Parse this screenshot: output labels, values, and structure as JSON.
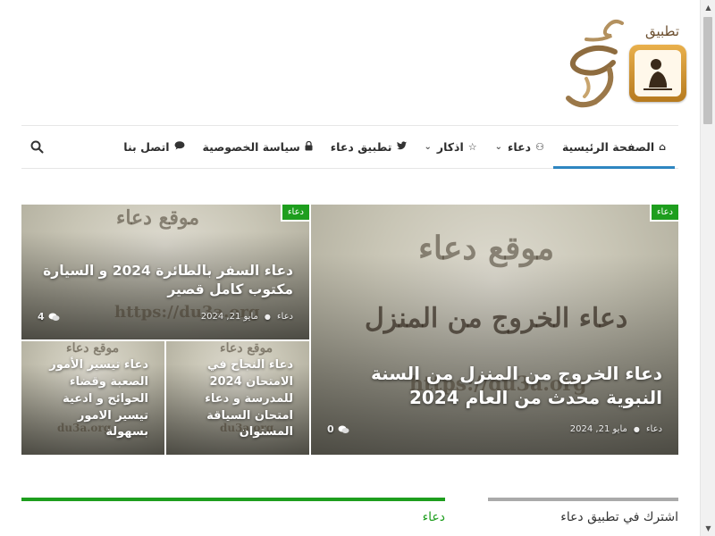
{
  "logo": {
    "app_label": "تطبيق"
  },
  "nav": {
    "items": [
      {
        "label": "الصفحة الرئيسية",
        "icon": "home-icon",
        "active": true
      },
      {
        "label": "دعاء",
        "icon": "gamepad-icon",
        "dropdown": true
      },
      {
        "label": "اذكار",
        "icon": "star-icon",
        "dropdown": true
      },
      {
        "label": "تطبيق دعاء",
        "icon": "twitter-icon"
      },
      {
        "label": "سياسة الخصوصية",
        "icon": "lock-icon"
      },
      {
        "label": "اتصل بنا",
        "icon": "chat-icon"
      }
    ]
  },
  "cards": {
    "main": {
      "tag": "دعاء",
      "title": "دعاء الخروج من المنزل من السنة النبوية محدث من العام 2024",
      "author": "دعاء",
      "date": "مايو 21, 2024",
      "comments": "0",
      "image_text": {
        "line1": "موقع دعاء",
        "line2": "دعاء الخروج من المنزل",
        "url": "https://du3a.org"
      }
    },
    "top_left": {
      "tag": "دعاء",
      "title": "دعاء السفر بالطائرة 2024 و السيارة مكتوب كامل قصير",
      "author": "دعاء",
      "date": "مايو 21, 2024",
      "comments": "4",
      "image_text": {
        "line1": "موقع دعاء",
        "url": "https://du3a.org"
      }
    },
    "small_right": {
      "title": "دعاء النجاح في الامتحان 2024 للمدرسة و دعاء امتحان السياقة المستوان",
      "image_text": {
        "line1": "موقع دعاء",
        "url": "du3a.org"
      }
    },
    "small_left": {
      "title": "دعاء تيسير الأمور الصعبة وقضاء الحوائج و ادعية تيسير الامور بسهولة",
      "image_text": {
        "line1": "موقع دعاء",
        "url": "du3a.org"
      }
    }
  },
  "sections": {
    "right": {
      "label": "اشترك في تطبيق دعاء",
      "color": "#aaaaaa"
    },
    "left": {
      "label": "دعاء",
      "color": "#1e9e1e"
    }
  },
  "colors": {
    "accent": "#2e86c1",
    "tag_green": "#1e9e1e"
  }
}
